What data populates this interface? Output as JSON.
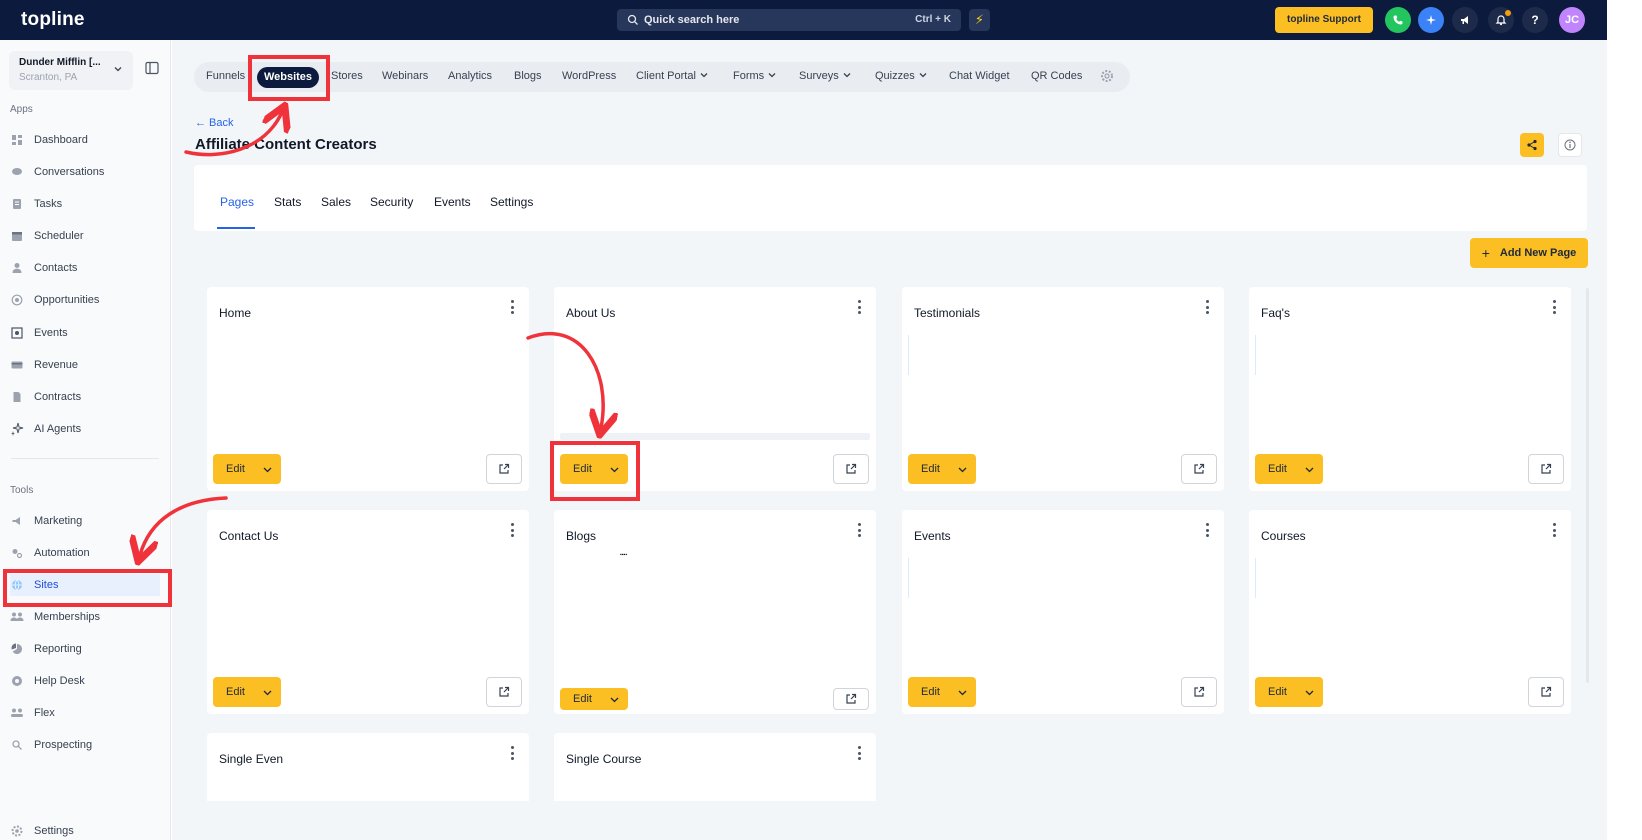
{
  "topbar": {
    "logo": "topline",
    "search_placeholder": "Quick search here",
    "search_shortcut": "Ctrl + K",
    "support_label": "topline Support",
    "avatar_initials": "JC",
    "colors": {
      "bg": "#0c1b3d",
      "accent": "#fbbf24",
      "phone": "#22c55e",
      "ai": "#3b82f6",
      "avatar": "#c084fc"
    }
  },
  "sidebar": {
    "account_name": "Dunder Mifflin [...",
    "account_location": "Scranton, PA",
    "apps_label": "Apps",
    "tools_label": "Tools",
    "apps": [
      {
        "label": "Dashboard",
        "icon": "dashboard-icon"
      },
      {
        "label": "Conversations",
        "icon": "chat-icon"
      },
      {
        "label": "Tasks",
        "icon": "tasks-icon"
      },
      {
        "label": "Scheduler",
        "icon": "calendar-icon"
      },
      {
        "label": "Contacts",
        "icon": "user-icon"
      },
      {
        "label": "Opportunities",
        "icon": "target-icon"
      },
      {
        "label": "Events",
        "icon": "events-icon"
      },
      {
        "label": "Revenue",
        "icon": "credit-card-icon"
      },
      {
        "label": "Contracts",
        "icon": "document-icon"
      },
      {
        "label": "AI Agents",
        "icon": "sparkles-icon"
      }
    ],
    "tools": [
      {
        "label": "Marketing",
        "icon": "megaphone-icon"
      },
      {
        "label": "Automation",
        "icon": "gears-icon"
      },
      {
        "label": "Sites",
        "icon": "globe-icon"
      },
      {
        "label": "Memberships",
        "icon": "members-icon"
      },
      {
        "label": "Reporting",
        "icon": "pie-chart-icon"
      },
      {
        "label": "Help Desk",
        "icon": "help-icon"
      },
      {
        "label": "Flex",
        "icon": "flex-icon"
      },
      {
        "label": "Prospecting",
        "icon": "search-icon"
      }
    ],
    "settings_label": "Settings"
  },
  "subnav": {
    "items": [
      {
        "label": "Funnels"
      },
      {
        "label": "Websites",
        "active": true
      },
      {
        "label": "Stores"
      },
      {
        "label": "Webinars"
      },
      {
        "label": "Analytics"
      },
      {
        "label": "Blogs"
      },
      {
        "label": "WordPress"
      },
      {
        "label": "Client Portal",
        "dropdown": true
      },
      {
        "label": "Forms",
        "dropdown": true
      },
      {
        "label": "Surveys",
        "dropdown": true
      },
      {
        "label": "Quizzes",
        "dropdown": true
      },
      {
        "label": "Chat Widget"
      },
      {
        "label": "QR Codes"
      }
    ]
  },
  "page": {
    "back_label": "← Back",
    "title": "Affiliate Content Creators",
    "tabs": [
      "Pages",
      "Stats",
      "Sales",
      "Security",
      "Events",
      "Settings"
    ],
    "active_tab": "Pages",
    "add_page_label": "Add New Page",
    "cards": [
      {
        "title": "Home"
      },
      {
        "title": "About Us"
      },
      {
        "title": "Testimonials"
      },
      {
        "title": "Faq's"
      },
      {
        "title": "Contact Us"
      },
      {
        "title": "Blogs"
      },
      {
        "title": "Events"
      },
      {
        "title": "Courses"
      },
      {
        "title": "Single Even"
      },
      {
        "title": "Single Course"
      }
    ],
    "edit_label": "Edit"
  },
  "annotation_color": "#f0333b"
}
